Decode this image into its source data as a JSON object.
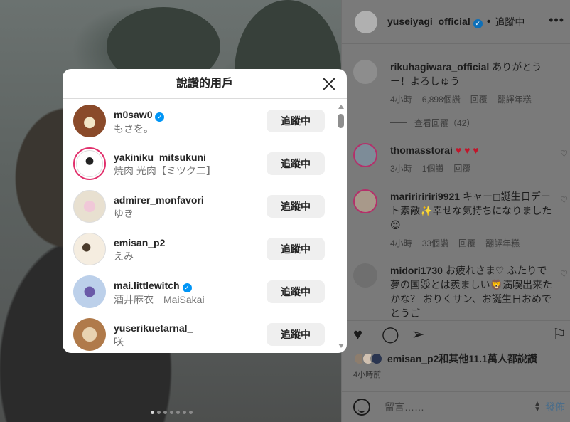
{
  "post_header": {
    "username": "yuseiyagi_official",
    "dot": "•",
    "follow_status": "追蹤中",
    "more": "•••"
  },
  "comments": [
    {
      "username": "rikuhagiwara_official",
      "text": "ありがとうー！よろしゅう",
      "time": "4小時",
      "likes": "6,898個讚",
      "reply": "回覆",
      "translate": "翻譯年糕",
      "view_replies": "查看回覆（42）"
    },
    {
      "username": "thomasstorai",
      "text": "♥ ♥ ♥",
      "time": "3小時",
      "likes": "1個讚",
      "reply": "回覆"
    },
    {
      "username": "maririririri9921",
      "text": "キャー◻︎誕生日デート素敵✨幸せな気持ちになりました😍",
      "time": "4小時",
      "likes": "33個讚",
      "reply": "回覆",
      "translate": "翻譯年糕"
    },
    {
      "username": "midori1730",
      "text": "お疲れさま♡ ふたりで夢の国🐭とは羨ましい🦁満喫出来たかな？ おりくサン、お誕生日おめでとうご",
      "time": "",
      "likes": "",
      "reply": ""
    }
  ],
  "likes_summary": {
    "text": "emisan_p2和其他11.1萬人都說讚",
    "time_ago": "4小時前"
  },
  "comment_box": {
    "placeholder": "留言……",
    "post": "發佈"
  },
  "modal": {
    "title": "說讚的用戶",
    "users": [
      {
        "handle": "m0saw0",
        "name": "もさを。",
        "verified": true,
        "button": "追蹤中",
        "avatar_color": "#8a4a2a"
      },
      {
        "handle": "yakiniku_mitsukuni",
        "name": "焼肉 光肉【ミツク二】",
        "verified": false,
        "button": "追蹤中",
        "avatar_color": "#ffffff"
      },
      {
        "handle": "admirer_monfavori",
        "name": "ゆき",
        "verified": false,
        "button": "追蹤中",
        "avatar_color": "#e8d6c8"
      },
      {
        "handle": "emisan_p2",
        "name": "えみ",
        "verified": false,
        "button": "追蹤中",
        "avatar_color": "#d8c9b5"
      },
      {
        "handle": "mai.littlewitch",
        "name": "酒井麻衣　MaiSakai",
        "verified": true,
        "button": "追蹤中",
        "avatar_color": "#9fb6d8"
      },
      {
        "handle": "yuserikuetarnal_",
        "name": "咲",
        "verified": false,
        "button": "追蹤中",
        "avatar_color": "#b07a4a"
      }
    ]
  },
  "colors": {
    "like_heart": "#c0162b",
    "verified": "#0095f6",
    "story_ring": "#e1306c"
  }
}
